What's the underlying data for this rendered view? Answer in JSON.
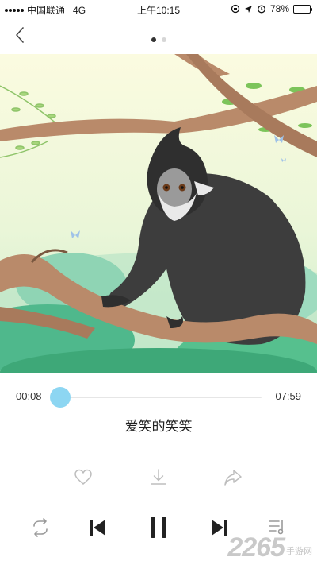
{
  "status_bar": {
    "carrier": "中国联通",
    "network": "4G",
    "time": "上午10:15",
    "battery_text": "78%",
    "battery_level": 0.78
  },
  "pager": {
    "pages": 2,
    "active_index": 0
  },
  "player": {
    "current_time": "00:08",
    "total_time": "07:59",
    "progress": 0.017,
    "song_title": "爱笑的笑笑"
  },
  "actions": [
    "heart-icon",
    "download-icon",
    "share-icon"
  ],
  "controls": [
    "repeat-icon",
    "previous-icon",
    "pause-icon",
    "next-icon",
    "playlist-icon"
  ],
  "watermark": {
    "brand": "2265",
    "site": "手游网"
  },
  "colors": {
    "accent": "#8dd6f2",
    "icon": "#bdbdbd",
    "control": "#222222"
  }
}
